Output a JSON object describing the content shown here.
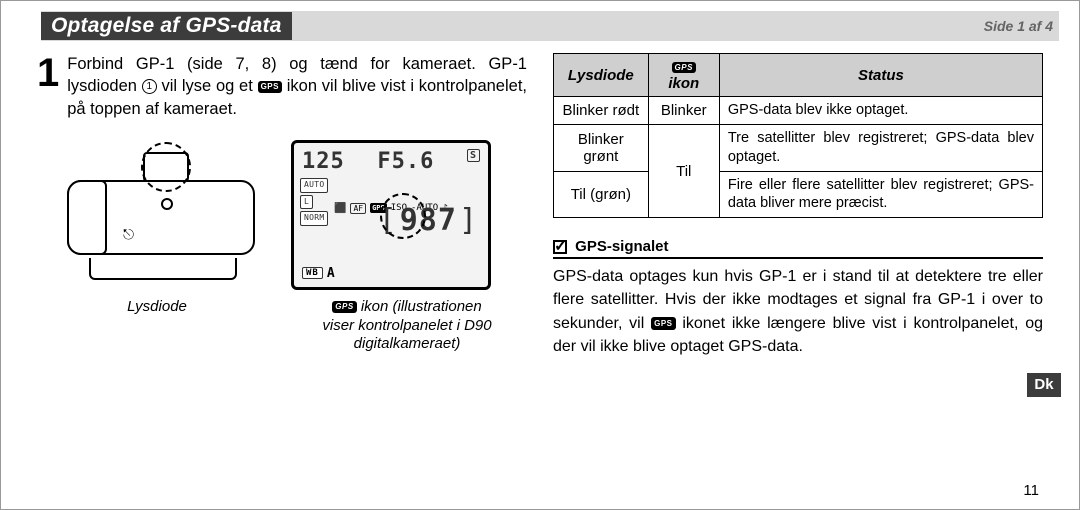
{
  "header": {
    "title": "Optagelse af GPS-data",
    "side_page": "Side 1 af 4"
  },
  "step1": {
    "number": "1",
    "text_before": "Forbind GP-1 (side 7, 8) og tænd for kameraet. GP-1 lysdioden ",
    "circled": "1",
    "text_mid": " vil lyse og et ",
    "gps_badge": "GPS",
    "text_after": " ikon vil blive vist i kontrolpanelet, på toppen af kameraet."
  },
  "lcd": {
    "shutter": "125",
    "aperture": "F5.6",
    "s_mode": "S",
    "auto": "AUTO",
    "quality": "L",
    "norm": "NORM",
    "af": "AF",
    "gps": "GPS",
    "iso": "ISO",
    "iso_auto": "-AUTO",
    "music": "♪",
    "count": "987",
    "wb": "WB",
    "wb_mode": "A"
  },
  "captions": {
    "left": "Lysdiode",
    "right_line1_badge": "GPS",
    "right_line1": " ikon (illustrationen",
    "right_line2": "viser kontrolpanelet i D90",
    "right_line3": "digitalkameraet)"
  },
  "table": {
    "headers": {
      "col1": "Lysdiode",
      "col2_badge": "GPS",
      "col2": " ikon",
      "col3": "Status"
    },
    "rows": [
      {
        "led": "Blinker rødt",
        "icon": "Blinker",
        "status": "GPS-data blev ikke optaget."
      },
      {
        "led": "Blinker grønt",
        "icon": "Til",
        "status": "Tre satellitter blev registreret; GPS-data blev optaget."
      },
      {
        "led": "Til (grøn)",
        "icon": "Til",
        "status": "Fire eller flere satellitter blev registreret; GPS-data bliver mere præcist."
      }
    ]
  },
  "note": {
    "heading": " GPS-signalet",
    "body_pre": "GPS-data optages kun hvis GP-1 er i stand til at detektere tre eller flere satellitter. Hvis der ikke modtages et signal fra GP-1 i over to sekunder, vil ",
    "gps_badge": "GPS",
    "body_post": " ikonet ikke længere blive vist i kontrolpanelet, og der vil ikke blive optaget GPS-data."
  },
  "lang_tab": "Dk",
  "page_number": "11"
}
